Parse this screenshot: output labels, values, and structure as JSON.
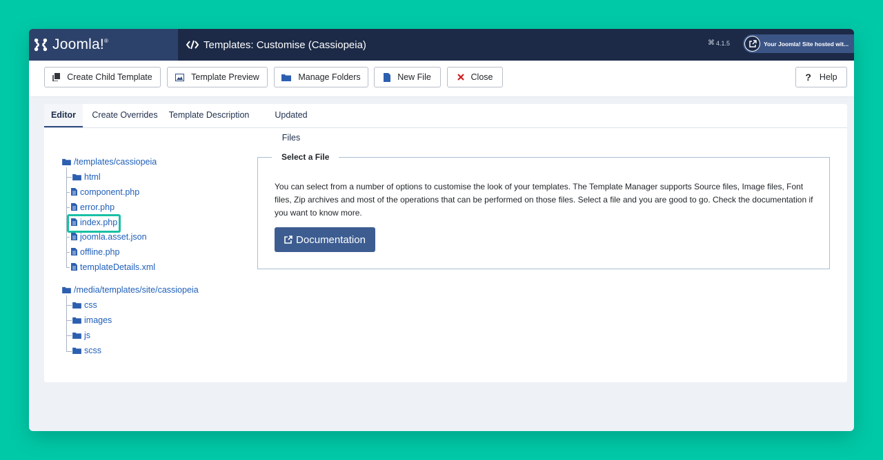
{
  "header": {
    "logo_text": "Joomla!",
    "page_title": "Templates: Customise (Cassiopeia)",
    "version": "4.1.5",
    "site_link": "Your Joomla! Site hosted wit..."
  },
  "toolbar": {
    "create_child_label": "Create Child Template",
    "preview_label": "Template Preview",
    "manage_folders_label": "Manage Folders",
    "new_file_label": "New File",
    "close_label": "Close",
    "help_label": "Help"
  },
  "tabs": [
    "Editor",
    "Create Overrides",
    "Template Description",
    "Updated Files"
  ],
  "tree": {
    "root1": "/templates/cassiopeia",
    "root1_items": [
      "html",
      "component.php",
      "error.php",
      "index.php",
      "joomla.asset.json",
      "offline.php",
      "templateDetails.xml"
    ],
    "root2": "/media/templates/site/cassiopeia",
    "root2_items": [
      "css",
      "images",
      "js",
      "scss"
    ]
  },
  "panel": {
    "legend": "Select a File",
    "description": "You can select from a number of options to customise the look of your templates. The Template Manager supports Source files, Image files, Font files, Zip archives and most of the operations that can be performed on those files. Select a file and you are good to go. Check the documentation if you want to know more.",
    "doc_button": "Documentation"
  },
  "colors": {
    "page_bg": "#00c9a7",
    "header_bg": "#1c2a47",
    "logo_bg": "#2d426b",
    "link": "#1f5fb9",
    "button_primary": "#3d5d91",
    "highlight": "#19c0a4",
    "close_icon": "#d11d1d"
  },
  "icons": [
    "joomla-logo-icon",
    "code-icon",
    "external-link-icon",
    "copy-icon",
    "image-icon",
    "folder-icon",
    "file-icon",
    "close-x-icon",
    "question-icon"
  ]
}
